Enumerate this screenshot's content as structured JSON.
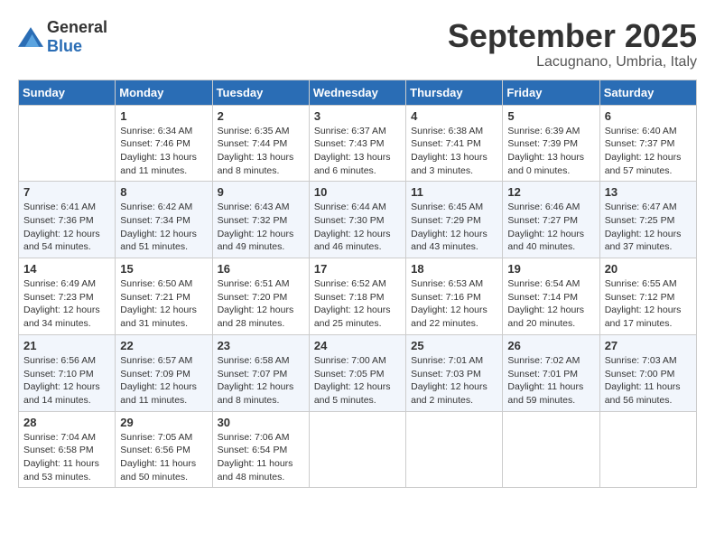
{
  "logo": {
    "text_general": "General",
    "text_blue": "Blue"
  },
  "title": {
    "month": "September 2025",
    "location": "Lacugnano, Umbria, Italy"
  },
  "headers": [
    "Sunday",
    "Monday",
    "Tuesday",
    "Wednesday",
    "Thursday",
    "Friday",
    "Saturday"
  ],
  "weeks": [
    [
      {
        "day": "",
        "info": ""
      },
      {
        "day": "1",
        "info": "Sunrise: 6:34 AM\nSunset: 7:46 PM\nDaylight: 13 hours\nand 11 minutes."
      },
      {
        "day": "2",
        "info": "Sunrise: 6:35 AM\nSunset: 7:44 PM\nDaylight: 13 hours\nand 8 minutes."
      },
      {
        "day": "3",
        "info": "Sunrise: 6:37 AM\nSunset: 7:43 PM\nDaylight: 13 hours\nand 6 minutes."
      },
      {
        "day": "4",
        "info": "Sunrise: 6:38 AM\nSunset: 7:41 PM\nDaylight: 13 hours\nand 3 minutes."
      },
      {
        "day": "5",
        "info": "Sunrise: 6:39 AM\nSunset: 7:39 PM\nDaylight: 13 hours\nand 0 minutes."
      },
      {
        "day": "6",
        "info": "Sunrise: 6:40 AM\nSunset: 7:37 PM\nDaylight: 12 hours\nand 57 minutes."
      }
    ],
    [
      {
        "day": "7",
        "info": "Sunrise: 6:41 AM\nSunset: 7:36 PM\nDaylight: 12 hours\nand 54 minutes."
      },
      {
        "day": "8",
        "info": "Sunrise: 6:42 AM\nSunset: 7:34 PM\nDaylight: 12 hours\nand 51 minutes."
      },
      {
        "day": "9",
        "info": "Sunrise: 6:43 AM\nSunset: 7:32 PM\nDaylight: 12 hours\nand 49 minutes."
      },
      {
        "day": "10",
        "info": "Sunrise: 6:44 AM\nSunset: 7:30 PM\nDaylight: 12 hours\nand 46 minutes."
      },
      {
        "day": "11",
        "info": "Sunrise: 6:45 AM\nSunset: 7:29 PM\nDaylight: 12 hours\nand 43 minutes."
      },
      {
        "day": "12",
        "info": "Sunrise: 6:46 AM\nSunset: 7:27 PM\nDaylight: 12 hours\nand 40 minutes."
      },
      {
        "day": "13",
        "info": "Sunrise: 6:47 AM\nSunset: 7:25 PM\nDaylight: 12 hours\nand 37 minutes."
      }
    ],
    [
      {
        "day": "14",
        "info": "Sunrise: 6:49 AM\nSunset: 7:23 PM\nDaylight: 12 hours\nand 34 minutes."
      },
      {
        "day": "15",
        "info": "Sunrise: 6:50 AM\nSunset: 7:21 PM\nDaylight: 12 hours\nand 31 minutes."
      },
      {
        "day": "16",
        "info": "Sunrise: 6:51 AM\nSunset: 7:20 PM\nDaylight: 12 hours\nand 28 minutes."
      },
      {
        "day": "17",
        "info": "Sunrise: 6:52 AM\nSunset: 7:18 PM\nDaylight: 12 hours\nand 25 minutes."
      },
      {
        "day": "18",
        "info": "Sunrise: 6:53 AM\nSunset: 7:16 PM\nDaylight: 12 hours\nand 22 minutes."
      },
      {
        "day": "19",
        "info": "Sunrise: 6:54 AM\nSunset: 7:14 PM\nDaylight: 12 hours\nand 20 minutes."
      },
      {
        "day": "20",
        "info": "Sunrise: 6:55 AM\nSunset: 7:12 PM\nDaylight: 12 hours\nand 17 minutes."
      }
    ],
    [
      {
        "day": "21",
        "info": "Sunrise: 6:56 AM\nSunset: 7:10 PM\nDaylight: 12 hours\nand 14 minutes."
      },
      {
        "day": "22",
        "info": "Sunrise: 6:57 AM\nSunset: 7:09 PM\nDaylight: 12 hours\nand 11 minutes."
      },
      {
        "day": "23",
        "info": "Sunrise: 6:58 AM\nSunset: 7:07 PM\nDaylight: 12 hours\nand 8 minutes."
      },
      {
        "day": "24",
        "info": "Sunrise: 7:00 AM\nSunset: 7:05 PM\nDaylight: 12 hours\nand 5 minutes."
      },
      {
        "day": "25",
        "info": "Sunrise: 7:01 AM\nSunset: 7:03 PM\nDaylight: 12 hours\nand 2 minutes."
      },
      {
        "day": "26",
        "info": "Sunrise: 7:02 AM\nSunset: 7:01 PM\nDaylight: 11 hours\nand 59 minutes."
      },
      {
        "day": "27",
        "info": "Sunrise: 7:03 AM\nSunset: 7:00 PM\nDaylight: 11 hours\nand 56 minutes."
      }
    ],
    [
      {
        "day": "28",
        "info": "Sunrise: 7:04 AM\nSunset: 6:58 PM\nDaylight: 11 hours\nand 53 minutes."
      },
      {
        "day": "29",
        "info": "Sunrise: 7:05 AM\nSunset: 6:56 PM\nDaylight: 11 hours\nand 50 minutes."
      },
      {
        "day": "30",
        "info": "Sunrise: 7:06 AM\nSunset: 6:54 PM\nDaylight: 11 hours\nand 48 minutes."
      },
      {
        "day": "",
        "info": ""
      },
      {
        "day": "",
        "info": ""
      },
      {
        "day": "",
        "info": ""
      },
      {
        "day": "",
        "info": ""
      }
    ]
  ]
}
